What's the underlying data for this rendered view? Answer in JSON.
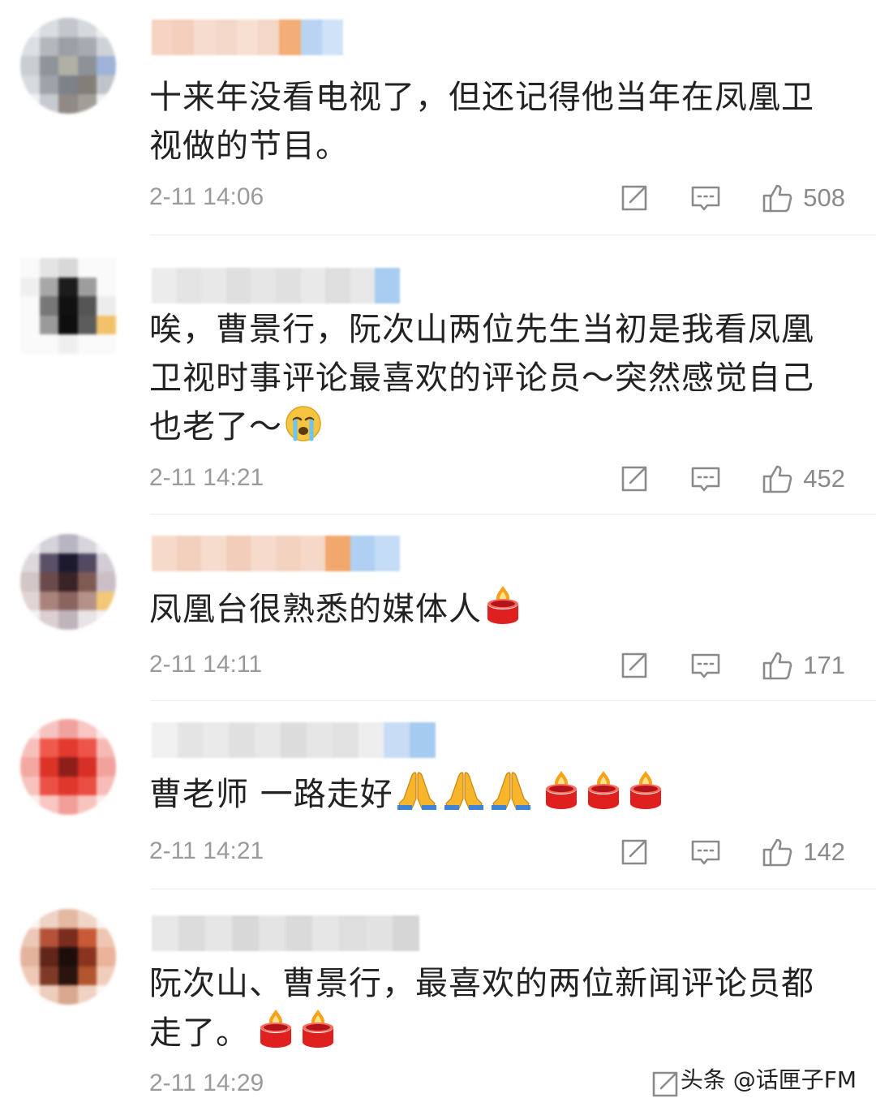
{
  "comments": [
    {
      "text": "十来年没看电视了，但还记得他当年在凤凰卫视做的节目。",
      "time": "2-11 14:06",
      "likes": "508",
      "emojis": []
    },
    {
      "text": "唉，曹景行，阮次山两位先生当初是我看凤凰卫视时事评论最喜欢的评论员～突然感觉自己也老了～",
      "time": "2-11 14:21",
      "likes": "452",
      "emojis": [
        "crying-face"
      ]
    },
    {
      "text": "凤凰台很熟悉的媒体人",
      "time": "2-11 14:11",
      "likes": "171",
      "emojis": [
        "candle"
      ]
    },
    {
      "text": "曹老师 一路走好",
      "time": "2-11 14:21",
      "likes": "142",
      "emojis": [
        "praying-hands",
        "praying-hands",
        "praying-hands",
        "candle",
        "candle",
        "candle"
      ]
    },
    {
      "text": "阮次山、曹景行，最喜欢的两位新闻评论员都走了。",
      "time": "2-11 14:29",
      "likes": "",
      "emojis": [
        "candle",
        "candle"
      ]
    }
  ],
  "icons": {
    "share": "share-icon",
    "reply": "comment-icon",
    "like": "thumbs-up-icon"
  },
  "watermark": "头条 @话匣子FM",
  "colors": {
    "text": "#222222",
    "meta": "#9a9a9a",
    "divider": "#ebebeb"
  }
}
